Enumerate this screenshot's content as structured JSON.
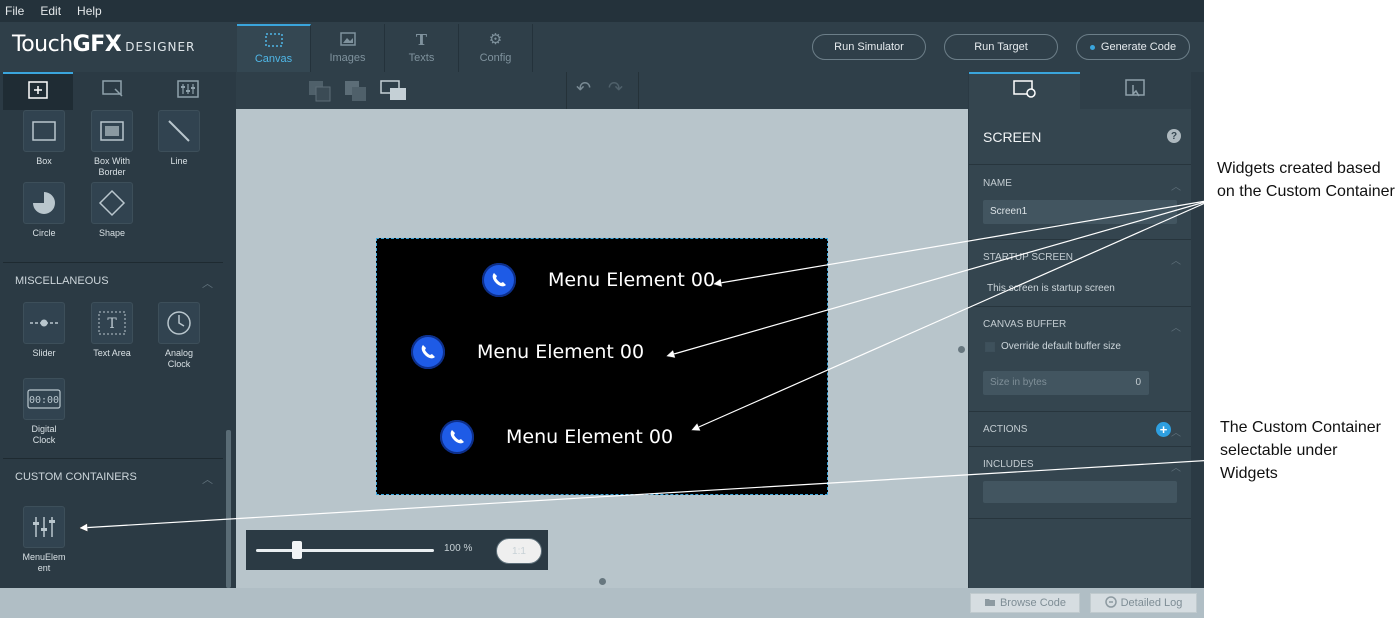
{
  "menubar": {
    "items": [
      "File",
      "Edit",
      "Help"
    ]
  },
  "logo": {
    "prefix": "Touch",
    "bold": "GFX",
    "sub": "DESIGNER"
  },
  "main_tabs": [
    {
      "label": "Canvas",
      "icon": "canvas-icon"
    },
    {
      "label": "Images",
      "icon": "image-icon"
    },
    {
      "label": "Texts",
      "icon": "text-icon"
    },
    {
      "label": "Config",
      "icon": "gears-icon"
    }
  ],
  "top_buttons": {
    "run_simulator": "Run Simulator",
    "run_target": "Run Target",
    "generate_code": "Generate Code"
  },
  "left_panel": {
    "shapes": [
      {
        "label": "Box",
        "icon": "box-icon"
      },
      {
        "label": "Box With Border",
        "icon": "box-with-border-icon"
      },
      {
        "label": "Line",
        "icon": "line-icon"
      },
      {
        "label": "Circle",
        "icon": "circle-icon"
      },
      {
        "label": "Shape",
        "icon": "shape-icon"
      }
    ],
    "misc_title": "MISCELLANEOUS",
    "misc": [
      {
        "label": "Slider",
        "icon": "slider-icon"
      },
      {
        "label": "Text Area",
        "icon": "text-area-icon"
      },
      {
        "label": "Analog Clock",
        "icon": "analog-clock-icon"
      },
      {
        "label": "Digital Clock",
        "icon": "digital-clock-icon"
      }
    ],
    "custom_title": "CUSTOM CONTAINERS",
    "custom": [
      {
        "label": "MenuElem ent",
        "icon": "custom-container-icon"
      }
    ]
  },
  "canvas": {
    "menu_elements": [
      "Menu Element 00",
      "Menu Element 00",
      "Menu Element 00"
    ],
    "zoom": {
      "value": "100 %",
      "fraction": 0.23,
      "reset_label": "1:1"
    }
  },
  "right_panel": {
    "title": "SCREEN",
    "name_title": "NAME",
    "name_value": "Screen1",
    "startup_title": "STARTUP SCREEN",
    "startup_text": "This screen is startup screen",
    "buffer_title": "CANVAS BUFFER",
    "buffer_checkbox": "Override default buffer size",
    "buffer_size_placeholder": "Size in bytes",
    "buffer_size_value": "0",
    "actions_title": "ACTIONS",
    "includes_title": "INCLUDES"
  },
  "statusbar": {
    "browse_code": "Browse Code",
    "detailed_log": "Detailed Log"
  },
  "annotations": {
    "widgets_created": "Widgets created based on the Custom Container",
    "custom_container": "The Custom Container selectable under Widgets"
  },
  "colors": {
    "accent": "#3aa5dc",
    "panel": "#2b3a44",
    "canvas_bg": "#b8c5cb",
    "phone_icon": "#1e5be6"
  }
}
